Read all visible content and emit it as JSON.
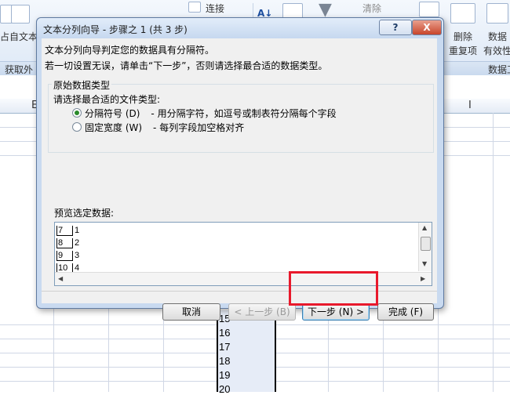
{
  "ribbon": {
    "connections_label": "连接",
    "clear_label": "清除",
    "from_text_label": "自文本",
    "from_access_partial": "占",
    "get_external_group": "获取外",
    "delete_duplicates_label_1": "删除",
    "delete_duplicates_label_2": "重复项",
    "data_validation_label_1": "数据",
    "data_validation_label_2": "有效性",
    "data_tools_group": "数据工"
  },
  "sheet": {
    "col_e": "E",
    "col_i": "I",
    "rows": [
      "15",
      "16",
      "17",
      "18",
      "19",
      "20"
    ]
  },
  "dialog": {
    "title": "文本分列向导 - 步骤之 1 (共 3 步)",
    "help_label": "?",
    "close_label": "X",
    "line1": "文本分列向导判定您的数据具有分隔符。",
    "line2": "若一切设置无误，请单击“下一步”，否则请选择最合适的数据类型。",
    "group_title": "原始数据类型",
    "group_sub": "请选择最合适的文件类型:",
    "options": [
      {
        "label": "分隔符号 (D)",
        "desc": "- 用分隔字符，如逗号或制表符分隔每个字段",
        "selected": true
      },
      {
        "label": "固定宽度 (W)",
        "desc": "- 每列字段加空格对齐",
        "selected": false
      }
    ],
    "preview_label": "预览选定数据:",
    "preview_rows": [
      {
        "row": "7",
        "value": "1"
      },
      {
        "row": "8",
        "value": "2"
      },
      {
        "row": "9",
        "value": "3"
      },
      {
        "row": "10",
        "value": "4"
      }
    ],
    "buttons": {
      "cancel": "取消",
      "back": "< 上一步 (B)",
      "next": "下一步 (N) >",
      "finish": "完成 (F)"
    }
  },
  "colors": {
    "highlight": "#e8192c",
    "radio_selected": "#2a8a2a"
  }
}
